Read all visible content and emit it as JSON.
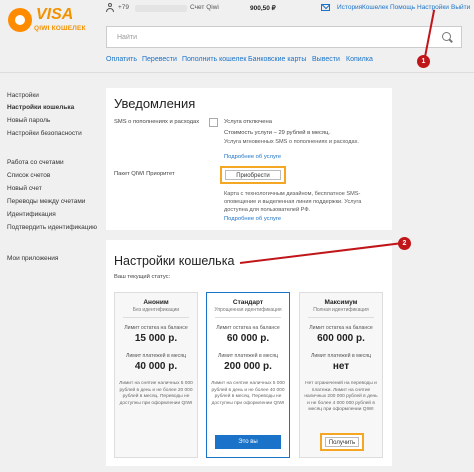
{
  "logo": {
    "brand": "VISA",
    "sub": "QIWI КОШЕЛЕК"
  },
  "topbar": {
    "phone": "+79",
    "account": "Счет Qiwi",
    "balance": "900,50 ₽",
    "links": [
      "История",
      "Кошелек",
      "Помощь",
      "Настройки",
      "Выйти"
    ]
  },
  "search": {
    "placeholder": "Найти"
  },
  "mainnav": [
    "Оплатить",
    "Перевести",
    "Пополнить кошелек",
    "Банковские карты",
    "Вывести",
    "Копилка"
  ],
  "sidebar": {
    "items": [
      "Настройки",
      "Настройки кошелька",
      "Новый пароль",
      "Настройки безопасности",
      "Работа со счетами",
      "Список счетов",
      "Новый счет",
      "Переводы между счетами",
      "Идентификация",
      "Подтвердить идентификацию",
      "Мои приложения"
    ]
  },
  "notifications": {
    "title": "Уведомления",
    "sms_label": "SMS о пополнениях и расходах",
    "sms_status": "Услуга отключена",
    "sms_cost": "Стоимость услуги – 29 рублей в месяц.",
    "sms_note": "Услуга мгновенных SMS о пополнениях и расходах.",
    "sms_link": "Подробнее об услуге",
    "priority_label": "Пакет QIWI Приоритет",
    "buy_button": "Приобрести",
    "priority_desc": "Карта с технологичным дизайном, бесплатное SMS-оповещение и выделенная линия поддержки. Услуга доступна для пользователей РФ.",
    "priority_link": "Подробнее об услуге"
  },
  "wallet": {
    "title": "Настройки кошелька",
    "status_label": "Ваш текущий статус:",
    "plans": [
      {
        "name": "Аноним",
        "sub": "Без идентификации",
        "balance_label": "Лимит остатка на балансе",
        "balance_value": "15 000 р.",
        "monthly_label": "Лимит платежей в месяц",
        "monthly_value": "40 000 р.",
        "note": "Лимит на снятие наличных 5 000 рублей в день и не более 20 000 рублей в месяц. Переводы не доступны при оформлении QIWI"
      },
      {
        "name": "Стандарт",
        "sub": "Упрощенная идентификация",
        "balance_label": "Лимит остатка на балансе",
        "balance_value": "60 000 р.",
        "monthly_label": "Лимит платежей в месяц",
        "monthly_value": "200 000 р.",
        "note": "Лимит на снятие наличных 5 000 рублей в день и не более 40 000 рублей в месяц. Переводы не доступны при оформлении QIWI",
        "button": "Это вы"
      },
      {
        "name": "Максимум",
        "sub": "Полная идентификация",
        "balance_label": "Лимит остатка на балансе",
        "balance_value": "600 000 р.",
        "monthly_label": "Лимит платежей в месяц",
        "monthly_value": "нет",
        "note": "Нет ограничений на переводы и платежи. Лимит на снятие наличных 200 000 рублей в день и не более 4 000 000 рублей в месяц при оформлении QIWI",
        "button": "Получить"
      }
    ]
  },
  "callouts": [
    "1",
    "2"
  ],
  "colors": {
    "accent": "#1a73c8",
    "brand": "#f39200",
    "highlight": "#f5a623",
    "callout": "#c0161a"
  }
}
